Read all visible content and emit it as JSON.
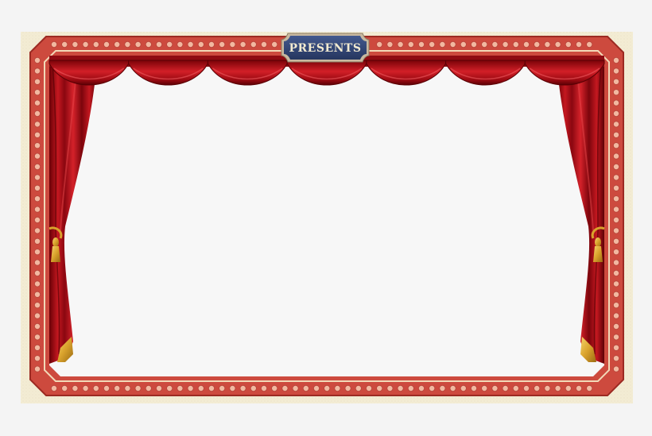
{
  "plaque": {
    "label": "PRESENTS"
  },
  "colors": {
    "page_background": "#f4f4f4",
    "parchment": "#f3ecd4",
    "frame_red": "#cd4a3e",
    "frame_dark_red": "#9c2a22",
    "bulb": "#f2b8a0",
    "curtain_red": "#b3101a",
    "curtain_dark": "#6a0006",
    "tassel_gold": "#e2b33a",
    "plaque_navy": "#33477a",
    "plaque_text": "#f2ead0",
    "stage_white": "#f7f7f7"
  },
  "icons": {
    "tassel_left": "tassel-icon",
    "tassel_right": "tassel-icon",
    "bulbs": "marquee-bulb-icon"
  }
}
